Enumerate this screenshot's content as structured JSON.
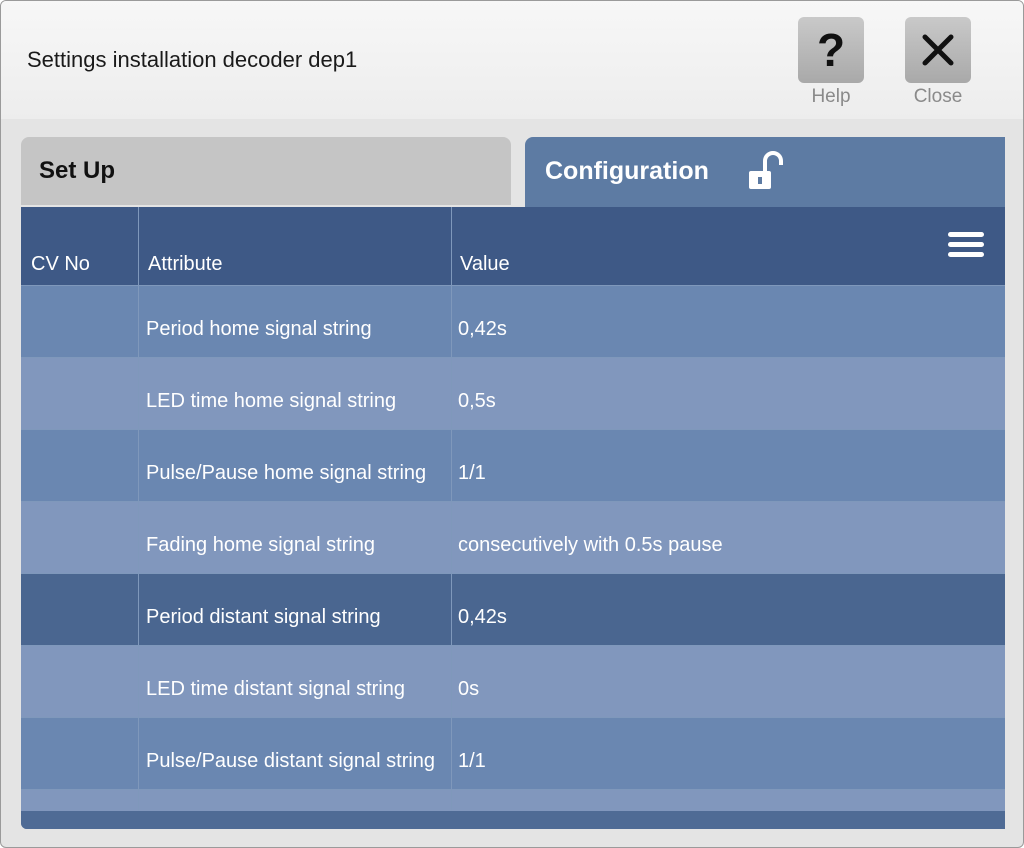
{
  "header": {
    "title": "Settings installation decoder dep1",
    "help_label": "Help",
    "close_label": "Close"
  },
  "tabs": [
    {
      "label": "Set Up",
      "active": false
    },
    {
      "label": "Configuration",
      "active": true,
      "icon": "unlocked-padlock-icon"
    }
  ],
  "table": {
    "columns": [
      "CV No",
      "Attribute",
      "Value"
    ],
    "rows": [
      {
        "cv": "",
        "attribute": "Period home signal string",
        "value": "0,42s"
      },
      {
        "cv": "",
        "attribute": "LED time home signal string",
        "value": "0,5s"
      },
      {
        "cv": "",
        "attribute": "Pulse/Pause home signal string",
        "value": "1/1"
      },
      {
        "cv": "",
        "attribute": "Fading home signal string",
        "value": "consecutively with 0.5s pause"
      },
      {
        "cv": "",
        "attribute": "Period distant signal string",
        "value": "0,42s",
        "selected": true
      },
      {
        "cv": "",
        "attribute": "LED time distant signal string",
        "value": "0s"
      },
      {
        "cv": "",
        "attribute": "Pulse/Pause distant signal string",
        "value": "1/1"
      }
    ]
  },
  "colors": {
    "header_row": "#3e5986",
    "row_a": "#6a87b1",
    "row_b": "#8197bd",
    "row_selected": "#4a6690",
    "active_tab": "#5d7ba3",
    "inactive_tab": "#c5c5c5"
  }
}
